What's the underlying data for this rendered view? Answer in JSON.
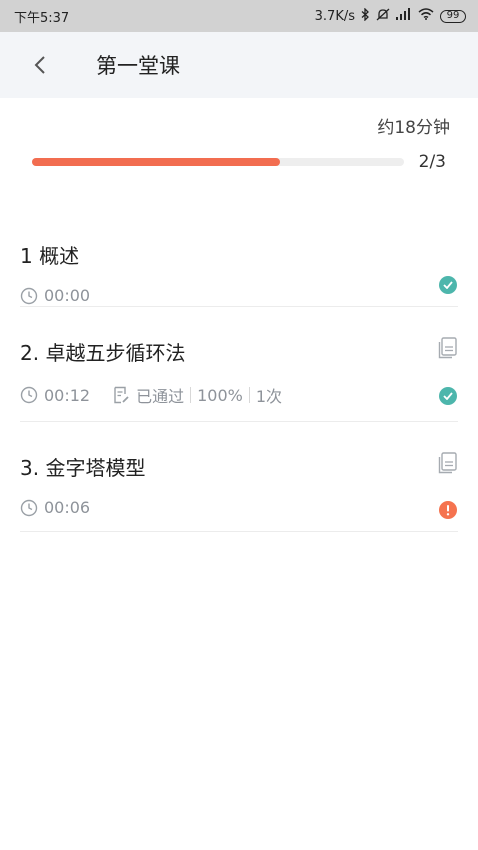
{
  "statusbar": {
    "time": "下午5:37",
    "network_speed": "3.7K/s",
    "battery": "99"
  },
  "header": {
    "title": "第一堂课"
  },
  "summary": {
    "duration": "约18分钟",
    "progress_text": "2/3",
    "progress_fraction": 0.667
  },
  "lessons": [
    {
      "title": "1 概述",
      "time": "00:00",
      "status": "completed"
    },
    {
      "title": "2. 卓越五步循环法",
      "time": "00:12",
      "quiz_status": "已通过",
      "quiz_score": "100%",
      "quiz_attempts": "1次",
      "status": "completed"
    },
    {
      "title": "3. 金字塔模型",
      "time": "00:06",
      "status": "incomplete"
    }
  ],
  "colors": {
    "accent": "#f26d50",
    "completed": "#4db6ac",
    "incomplete": "#f5734f"
  }
}
